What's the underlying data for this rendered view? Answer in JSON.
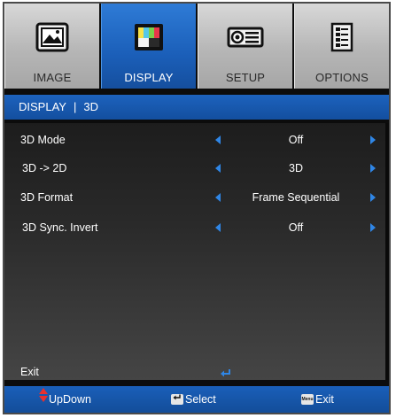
{
  "tabs": [
    {
      "label": "IMAGE",
      "icon": "image-icon",
      "active": false
    },
    {
      "label": "DISPLAY",
      "icon": "display-icon",
      "active": true
    },
    {
      "label": "SETUP",
      "icon": "setup-icon",
      "active": false
    },
    {
      "label": "OPTIONS",
      "icon": "options-icon",
      "active": false
    }
  ],
  "breadcrumb": {
    "section": "DISPLAY",
    "separator": "|",
    "page": "3D"
  },
  "settings": [
    {
      "label": "3D Mode",
      "value": "Off"
    },
    {
      "label": "3D -> 2D",
      "value": "3D"
    },
    {
      "label": "3D Format",
      "value": "Frame Sequential"
    },
    {
      "label": "3D Sync. Invert",
      "value": "Off"
    }
  ],
  "exit": {
    "label": "Exit",
    "icon": "enter-icon"
  },
  "footer": {
    "updown": "UpDown",
    "select": "Select",
    "exit": "Exit",
    "menu_key": "Menu"
  },
  "colors": {
    "accent": "#1b5fb9",
    "arrow": "#2f86e6",
    "updown_icon": "#e8302f"
  }
}
